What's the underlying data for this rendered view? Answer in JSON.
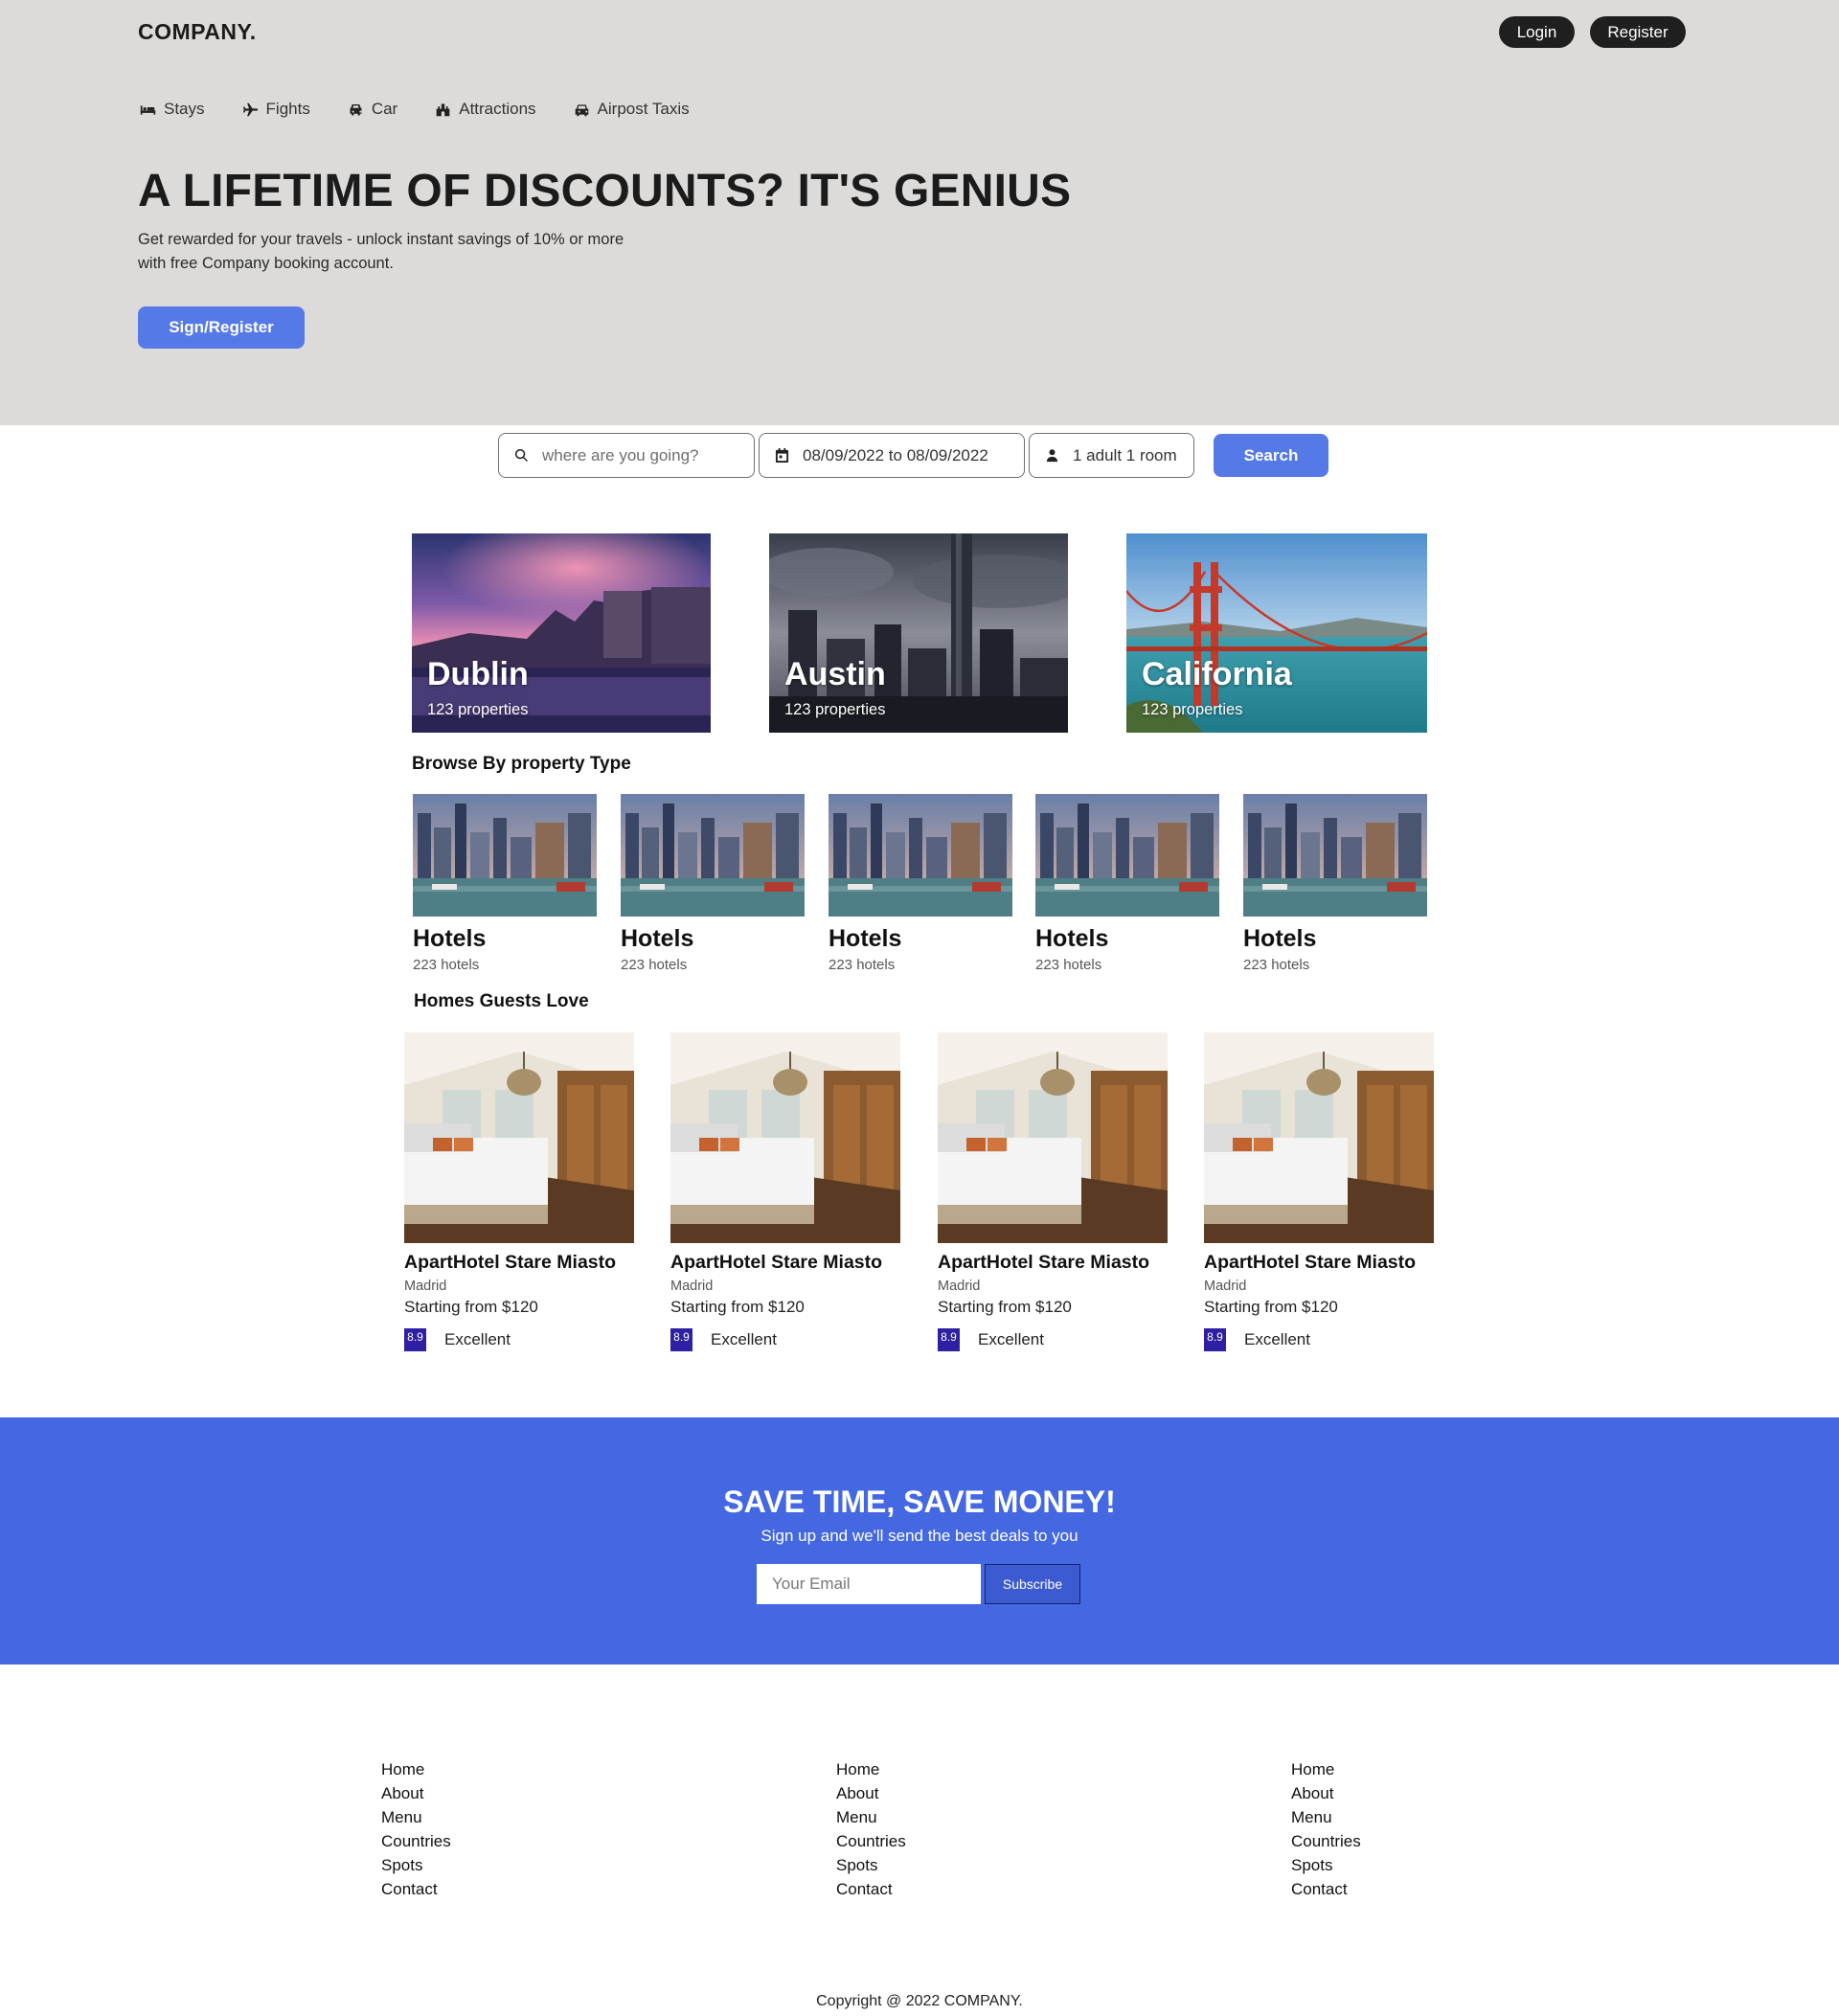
{
  "brand": "COMPANY.",
  "auth": {
    "login": "Login",
    "register": "Register"
  },
  "nav": [
    {
      "label": "Stays",
      "icon": "bed-icon"
    },
    {
      "label": "Fights",
      "icon": "plane-icon"
    },
    {
      "label": "Car",
      "icon": "car-icon"
    },
    {
      "label": "Attractions",
      "icon": "attraction-icon"
    },
    {
      "label": "Airpost Taxis",
      "icon": "taxi-icon"
    }
  ],
  "hero": {
    "title": "A LIFETIME OF DISCOUNTS? IT'S GENIUS",
    "subtitle": "Get rewarded for your travels - unlock instant savings of 10% or more with free Company booking account.",
    "button": "Sign/Register"
  },
  "search": {
    "placeholder": "where are you going?",
    "dates": "08/09/2022 to 08/09/2022",
    "guests": "1 adult 1 room",
    "button": "Search"
  },
  "cities": [
    {
      "name": "Dublin",
      "count": "123 properties"
    },
    {
      "name": "Austin",
      "count": "123 properties"
    },
    {
      "name": "California",
      "count": "123 properties"
    }
  ],
  "property_types": {
    "title": "Browse By property Type",
    "items": [
      {
        "name": "Hotels",
        "count": "223 hotels"
      },
      {
        "name": "Hotels",
        "count": "223 hotels"
      },
      {
        "name": "Hotels",
        "count": "223 hotels"
      },
      {
        "name": "Hotels",
        "count": "223 hotels"
      },
      {
        "name": "Hotels",
        "count": "223 hotels"
      }
    ]
  },
  "homes": {
    "title": "Homes Guests Love",
    "items": [
      {
        "name": "ApartHotel Stare Miasto",
        "city": "Madrid",
        "price": "Starting from $120",
        "score": "8.9",
        "rating": "Excellent"
      },
      {
        "name": "ApartHotel Stare Miasto",
        "city": "Madrid",
        "price": "Starting from $120",
        "score": "8.9",
        "rating": "Excellent"
      },
      {
        "name": "ApartHotel Stare Miasto",
        "city": "Madrid",
        "price": "Starting from $120",
        "score": "8.9",
        "rating": "Excellent"
      },
      {
        "name": "ApartHotel Stare Miasto",
        "city": "Madrid",
        "price": "Starting from $120",
        "score": "8.9",
        "rating": "Excellent"
      }
    ]
  },
  "newsletter": {
    "title": "SAVE TIME, SAVE MONEY!",
    "subtitle": "Sign up and we'll send the best deals to you",
    "placeholder": "Your Email",
    "button": "Subscribe"
  },
  "footer": {
    "columns": [
      [
        "Home",
        "About",
        "Menu",
        "Countries",
        "Spots",
        "Contact"
      ],
      [
        "Home",
        "About",
        "Menu",
        "Countries",
        "Spots",
        "Contact"
      ],
      [
        "Home",
        "About",
        "Menu",
        "Countries",
        "Spots",
        "Contact"
      ]
    ],
    "copyright": "Copyright @ 2022 COMPANY."
  },
  "colors": {
    "hero_bg": "#dcdbda",
    "accent": "#5579e6",
    "newsletter_bg": "#4468e2",
    "score_badge": "#2e1fa3"
  }
}
